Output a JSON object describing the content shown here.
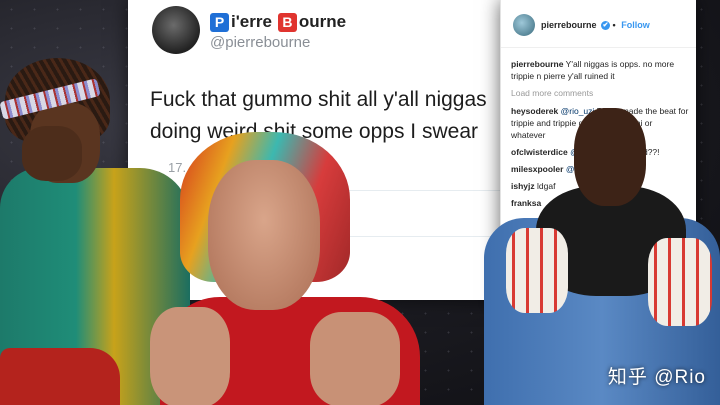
{
  "tweet": {
    "name_badge_1": "P",
    "name_part_1": "i'erre",
    "name_badge_2": "B",
    "name_part_2": "ourne",
    "handle": "@pierrebourne",
    "text": "Fuck that gummo shit all y'all niggas doing weird shit some opps I swear",
    "date": "17."
  },
  "instagram": {
    "username": "pierrebourne",
    "verified_icon": "✔",
    "separator": "•",
    "follow": "Follow",
    "caption_user": "pierrebourne",
    "caption_text": "Y'all niggas is opps. no more trippie n pierre y'all ruined it",
    "load_more": "Load more comments",
    "comments": [
      {
        "user": "heysoderek",
        "mention": "@rio_uzi",
        "text": " Pierre made the beat for trippie and trippie gave it to tekashi or whatever"
      },
      {
        "user": "ofclwisterdice",
        "mention": "@jig",
        "text": " what happened??!"
      },
      {
        "user": "milesxpooler",
        "mention": "@aka",
        "text": ""
      },
      {
        "user": "ishyjz",
        "mention": "",
        "text": " ldgaf"
      },
      {
        "user": "franksa",
        "mention": "",
        "text": ""
      }
    ]
  },
  "watermark": "知乎 @Rio",
  "colors": {
    "badge_p": "#1f6fd6",
    "badge_b": "#e0342f",
    "instagram_link": "#3897f0"
  }
}
